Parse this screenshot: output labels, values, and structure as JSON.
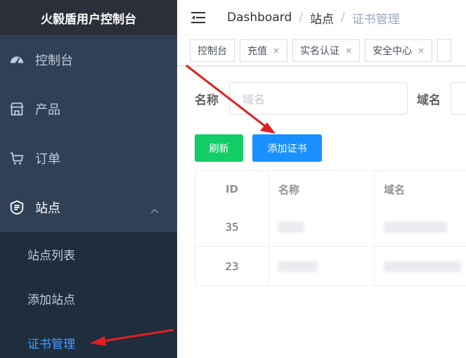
{
  "brand": {
    "title": "火毅盾用户控制台"
  },
  "sidebar": {
    "items": [
      {
        "label": "控制台",
        "icon": "dashboard-icon"
      },
      {
        "label": "产品",
        "icon": "shop-icon"
      },
      {
        "label": "订单",
        "icon": "cart-icon"
      },
      {
        "label": "站点",
        "icon": "site-icon",
        "expanded": true
      }
    ],
    "submenu": [
      {
        "label": "站点列表"
      },
      {
        "label": "添加站点"
      },
      {
        "label": "证书管理",
        "active": true
      }
    ]
  },
  "navbar": {
    "breadcrumb": [
      "Dashboard",
      "站点",
      "证书管理"
    ],
    "separator": "/"
  },
  "tags": [
    {
      "label": "控制台",
      "closable": false
    },
    {
      "label": "充值",
      "closable": true
    },
    {
      "label": "实名认证",
      "closable": true
    },
    {
      "label": "安全中心",
      "closable": true
    }
  ],
  "tag_close": "×",
  "search": {
    "name_label": "名称",
    "name_placeholder": "域名",
    "domain_label": "域名"
  },
  "buttons": {
    "refresh": "刷新",
    "add_cert": "添加证书"
  },
  "table": {
    "headers": [
      "ID",
      "名称",
      "域名"
    ],
    "rows": [
      {
        "id": "35"
      },
      {
        "id": "23"
      }
    ]
  },
  "colors": {
    "sidebar_bg": "#304156",
    "active": "#409eff",
    "refresh_btn": "#13ce66",
    "add_btn": "#1890ff",
    "annotation": "#e02020"
  }
}
